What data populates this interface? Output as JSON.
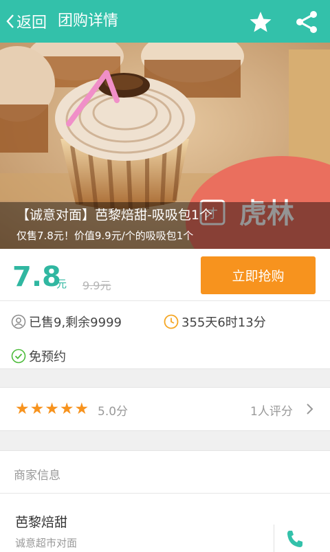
{
  "header": {
    "back_label": "返回",
    "title": "团购详情",
    "favorite_icon": "star-icon",
    "share_icon": "share-icon",
    "bg_color": "#33c1aa"
  },
  "hero": {
    "title": "【诚意对面】芭黎焙甜-吸吸包1个",
    "subtitle": "仅售7.8元！价值9.9元/个的吸吸包1个",
    "watermark": "虎林"
  },
  "price": {
    "current": "7.8",
    "unit": "元",
    "original": "9.9元",
    "buy_label": "立即抢购",
    "accent": "#30b7a1",
    "button_color": "#f7931e"
  },
  "info": {
    "sold": "已售9,剩余9999",
    "countdown": "355天6时13分",
    "no_reservation": "免预约"
  },
  "rating": {
    "stars": 5,
    "max_stars": 5,
    "score": "5.0分",
    "review_count": "1人评分"
  },
  "merchant": {
    "section_title": "商家信息",
    "name": "芭黎焙甜",
    "address": "诚意超市对面"
  }
}
